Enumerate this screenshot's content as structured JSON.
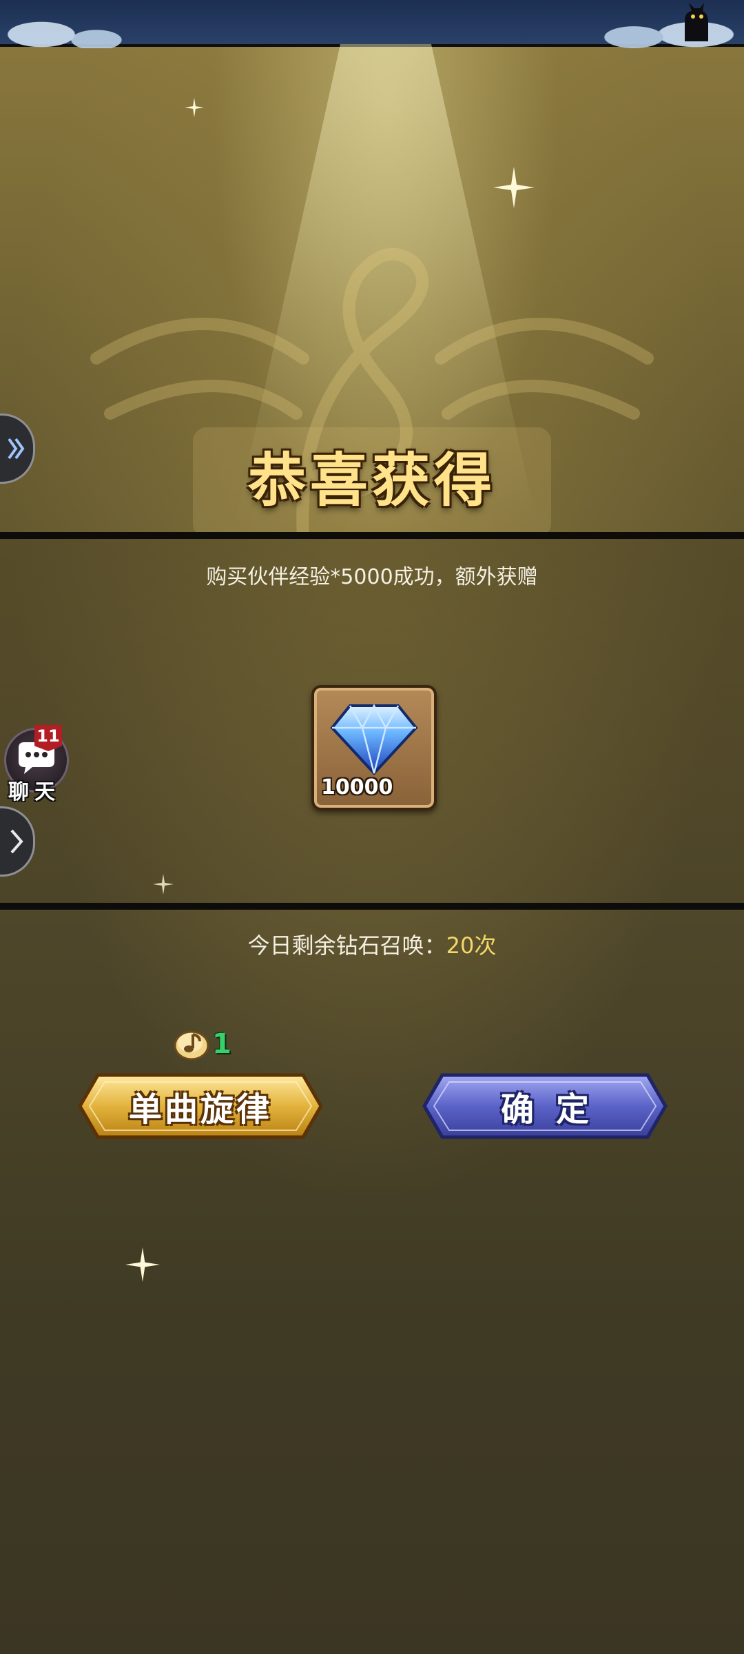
{
  "title": "恭喜获得",
  "message": "购买伙伴经验*5000成功，额外获赠",
  "reward": {
    "icon": "blue-diamond-icon",
    "quantity": "10000"
  },
  "remaining_summons": {
    "label": "今日剩余钻石召唤：",
    "count": "20次"
  },
  "cost": {
    "icon": "note-coin-icon",
    "value": "1"
  },
  "buttons": {
    "single_melody": "单曲旋律",
    "confirm": "确定"
  },
  "chat": {
    "label": "聊天",
    "badge": "11"
  },
  "side_tabs": [
    {
      "icon": "double-chevron-right-icon"
    },
    {
      "icon": "chevron-right-icon"
    }
  ],
  "colors": {
    "title": "#ffe28a",
    "melody_button": "#e0b23a",
    "confirm_button": "#5b63c8",
    "cost_value": "#38d06a",
    "summon_count": "#f4d86a",
    "badge": "#b31e24"
  }
}
